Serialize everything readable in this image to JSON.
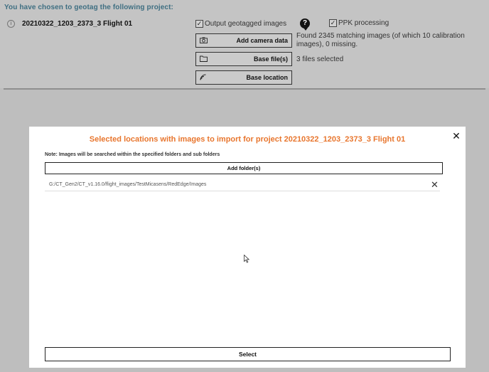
{
  "background": {
    "heading": "You have chosen to geotag the following project:",
    "project_name": "20210322_1203_2373_3 Flight 01",
    "output_geotagged_label": "Output geotagged images",
    "output_geotagged_checked": true,
    "ppk_label": "PPK processing",
    "ppk_checked": true,
    "help_icon_glyph": "?",
    "add_camera_label": "Add camera data",
    "camera_status_line1": "Found 2345 matching images (of which 10 calibration",
    "camera_status_line2": "images), 0 missing.",
    "base_files_label": "Base file(s)",
    "base_files_status": "3 files selected",
    "base_location_label": "Base location",
    "check_glyph": "✓",
    "info_glyph": "i"
  },
  "modal": {
    "title": "Selected locations with images to import for project 20210322_1203_2373_3 Flight 01",
    "close_glyph": "✕",
    "note": "Note: Images will be searched within the specified folders and sub folders",
    "add_folder_label": "Add folder(s)",
    "folders": [
      {
        "path": "G:/CT_Gen2/CT_v1.16.0/flight_images/TestMicasens/RedEdge/Images",
        "remove_glyph": "✕"
      }
    ],
    "select_label": "Select"
  },
  "colors": {
    "title_orange": "#e8762e",
    "heading_teal": "#3f6f82"
  }
}
